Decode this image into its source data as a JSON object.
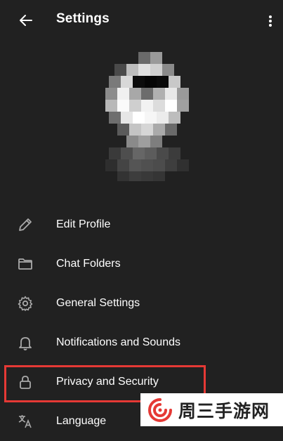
{
  "header": {
    "title": "Settings",
    "back_icon": "arrow-left-icon",
    "more_icon": "more-vertical-icon"
  },
  "profile": {
    "avatar": "pixelated-profile-photo"
  },
  "menu": {
    "items": [
      {
        "label": "Edit Profile",
        "icon": "pencil-icon"
      },
      {
        "label": "Chat Folders",
        "icon": "folder-icon"
      },
      {
        "label": "General Settings",
        "icon": "gear-icon"
      },
      {
        "label": "Notifications and Sounds",
        "icon": "bell-icon"
      },
      {
        "label": "Privacy and Security",
        "icon": "lock-icon",
        "highlighted": true
      },
      {
        "label": "Language",
        "icon": "translate-icon"
      }
    ]
  },
  "colors": {
    "background": "#212121",
    "text": "#ffffff",
    "icon": "#aaaaaa",
    "highlight": "#e53935"
  },
  "watermark": {
    "text": "周三手游网",
    "logo_color": "#e53935"
  }
}
